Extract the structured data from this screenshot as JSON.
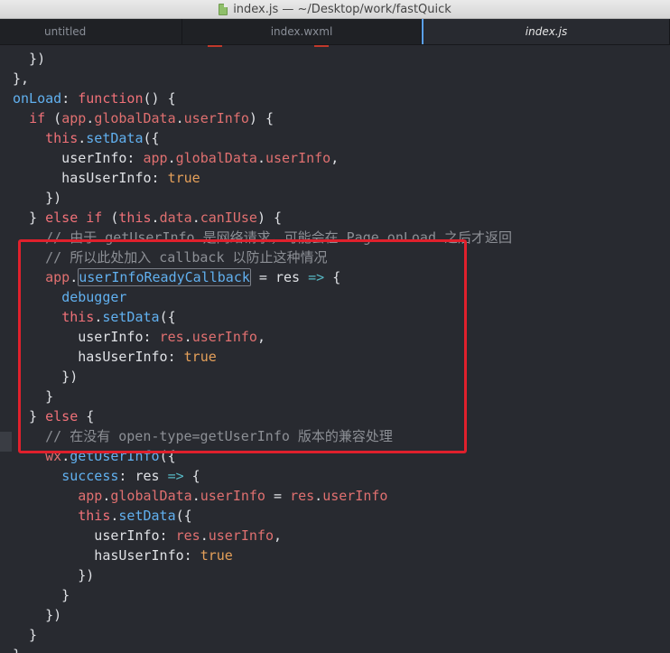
{
  "window": {
    "title": "index.js — ~/Desktop/work/fastQuick",
    "file_icon": "js-file-icon"
  },
  "tabs": [
    {
      "label": "untitled",
      "active": false
    },
    {
      "label": "index.wxml",
      "active": false
    },
    {
      "label": "index.js",
      "active": true
    }
  ],
  "code": {
    "lines": [
      "  })",
      "},",
      "onLoad: function() {",
      "  if (app.globalData.userInfo) {",
      "    this.setData({",
      "      userInfo: app.globalData.userInfo,",
      "      hasUserInfo: true",
      "    })",
      "  } else if (this.data.canIUse) {",
      "    // 由于 getUserInfo 是网络请求，可能会在 Page.onLoad 之后才返回",
      "    // 所以此处加入 callback 以防止这种情况",
      "    app.userInfoReadyCallback = res => {",
      "      debugger",
      "      this.setData({",
      "        userInfo: res.userInfo,",
      "        hasUserInfo: true",
      "      })",
      "    }",
      "  } else {",
      "    // 在没有 open-type=getUserInfo 版本的兼容处理",
      "    wx.getUserInfo({",
      "      success: res => {",
      "        app.globalData.userInfo = res.userInfo",
      "        this.setData({",
      "          userInfo: res.userInfo,",
      "          hasUserInfo: true",
      "        })",
      "      }",
      "    })",
      "  }",
      "}"
    ]
  },
  "colors": {
    "background": "#282a30",
    "annotation_box": "#e0202c",
    "keyword": "#f07178",
    "function": "#61b0ef",
    "boolean": "#e5a05a",
    "comment": "#8c8f95"
  }
}
